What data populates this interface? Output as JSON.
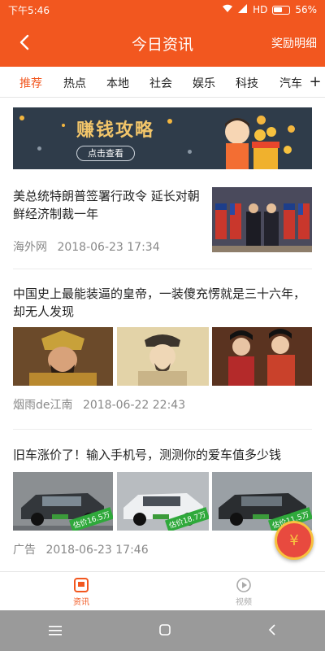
{
  "status": {
    "time": "下午5:46",
    "network": "HD",
    "battery": "56%"
  },
  "header": {
    "title": "今日资讯",
    "action": "奖励明细"
  },
  "tabs": [
    "推荐",
    "热点",
    "本地",
    "社会",
    "娱乐",
    "科技",
    "汽车"
  ],
  "banner": {
    "title": "赚钱攻略",
    "button": "点击查看"
  },
  "news": [
    {
      "title": "美总统特朗普签署行政令 延长对朝鲜经济制裁一年",
      "source": "海外网",
      "time": "2018-06-23 17:34"
    },
    {
      "title": "中国史上最能装逼的皇帝，一装傻充愣就是三十六年，却无人发现",
      "source": "烟雨de江南",
      "time": "2018-06-22 22:43"
    },
    {
      "title": "旧车涨价了！输入手机号，测测你的爱车值多少钱",
      "source": "广告",
      "time": "2018-06-23 17:46",
      "image_badges": [
        "估价16.5万",
        "估价18.7万",
        "估价11.5万"
      ]
    }
  ],
  "bottom_nav": [
    {
      "label": "资讯",
      "active": true
    },
    {
      "label": "视频",
      "active": false
    }
  ],
  "colors": {
    "accent": "#f2571f"
  }
}
